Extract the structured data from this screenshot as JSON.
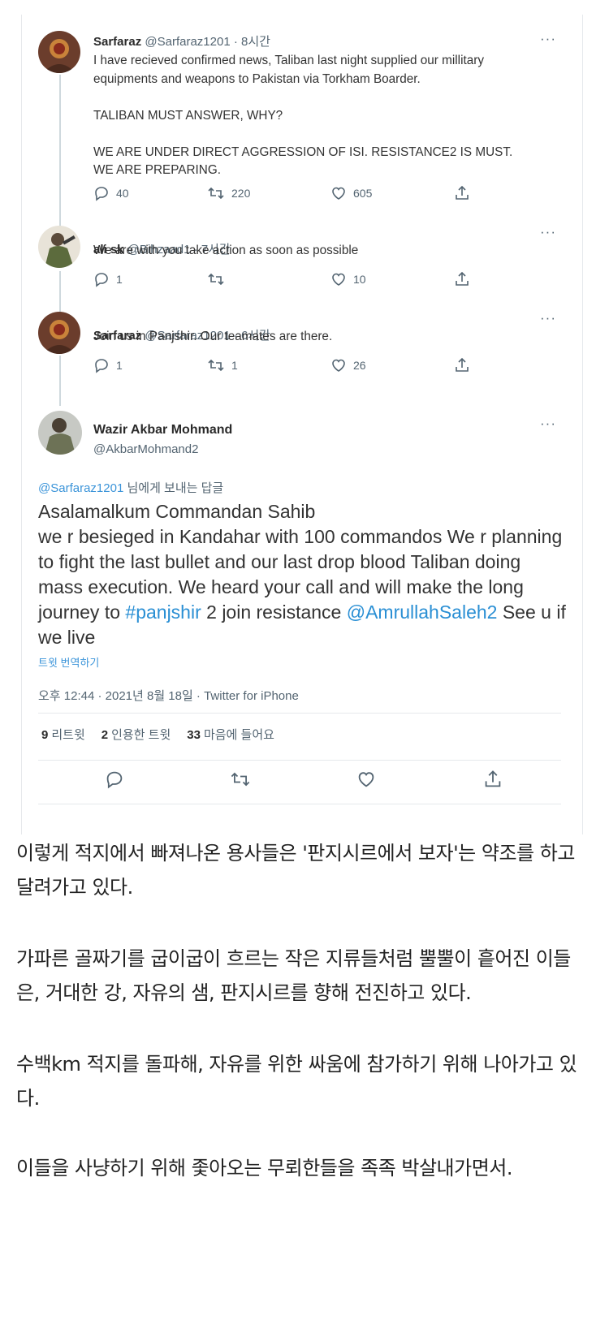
{
  "tweets": [
    {
      "name": "Sarfaraz",
      "handle": "@Sarfaraz1201",
      "time": "8시간",
      "text": "I have recieved confirmed news, Taliban last night supplied our millitary\nequipments and weapons to Pakistan via Torkham Boarder.\n\nTALIBAN  MUST ANSWER, WHY?\n\nWE ARE UNDER DIRECT AGGRESSION OF ISI. RESISTANCE2  IS MUST.\nWE ARE PREPARING.",
      "replies": "40",
      "retweets": "220",
      "likes": "605"
    },
    {
      "name": "ali sk",
      "handle": "@Bihzaad1",
      "time": "7시간",
      "text": "We are with you take action as soon as possible",
      "replies": "1",
      "retweets": "",
      "likes": "10"
    },
    {
      "name": "Sarfaraz",
      "handle": "@Sarfaraz1201",
      "time": "6시간",
      "text": "Join us in Panjshir. Our teamates are there.",
      "replies": "1",
      "retweets": "1",
      "likes": "26"
    }
  ],
  "main_tweet": {
    "name": "Wazir Akbar Mohmand",
    "handle": "@AkbarMohmand2",
    "reply_to_handle": "@Sarfaraz1201",
    "reply_to_suffix": " 님에게 보내는 답글",
    "text_1": "Asalamalkum Commandan Sahib\nwe r besieged in Kandahar with 100 commandos We r planning to fight the last bullet and our last drop blood Taliban doing mass execution. We heard your call and will make the long journey to ",
    "hashtag": "#panjshir",
    "text_2": " 2 join resistance ",
    "mention": "@AmrullahSaleh2",
    "text_3": " See u if we live",
    "translate": "트윗 번역하기",
    "timestamp": "오후 12:44 · 2021년 8월 18일 · Twitter for iPhone",
    "retweet_count": "9",
    "retweet_label": "리트윗",
    "quote_count": "2",
    "quote_label": "인용한 트윗",
    "like_count": "33",
    "like_label": "마음에 들어요"
  },
  "more_label": "···",
  "separator": "·",
  "paragraphs": [
    "이렇게 적지에서 빠져나온 용사들은 '판지시르에서 보자'는 약조를 하고 달려가고 있다.",
    "가파른 골짜기를 굽이굽이 흐르는 작은 지류들처럼 뿔뿔이 흩어진 이들은, 거대한 강, 자유의 샘, 판지시르를 향해 전진하고 있다.",
    "수백km 적지를 돌파해, 자유를 위한 싸움에 참가하기 위해 나아가고 있다.",
    "이들을 사냥하기 위해 좇아오는 무뢰한들을 족족 박살내가면서."
  ]
}
